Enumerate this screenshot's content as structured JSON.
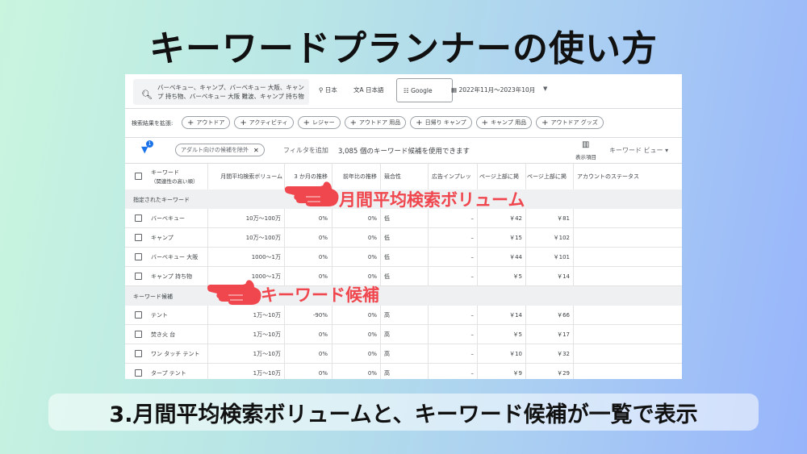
{
  "slide": {
    "title": "キーワードプランナーの使い方",
    "caption": "3.月間平均検索ボリュームと、キーワード候補が一覧で表示"
  },
  "toolbar": {
    "search_text": "バーベキュー、キャンプ、バーベキュー 大阪、キャンプ 持ち物、バーベキュー 大阪 難波、キャンプ 持ち物",
    "location": "日本",
    "language": "日本語",
    "engine": "Google",
    "date_range": "2022年11月～2023年10月"
  },
  "expand": {
    "label": "検索結果を拡張:",
    "chips": [
      "アウトドア",
      "アクティビティ",
      "レジャー",
      "アウトドア 用品",
      "日帰り キャンプ",
      "キャンプ 用品",
      "アウトドア グッズ"
    ]
  },
  "filter": {
    "badge": "1",
    "adult_chip": "アダルト向けの候補を除外",
    "add_filter": "フィルタを追加",
    "count_text": "3,085 個のキーワード候補を使用できます",
    "display_label": "表示項目",
    "view_label": "キーワード ビュー"
  },
  "table": {
    "headers": {
      "keyword": "キーワード",
      "keyword_sub": "（関連性の高い順）",
      "volume": "月間平均検索ボリューム",
      "three_month": "3 か月の推移",
      "yoy": "前年比の推移",
      "competition": "競合性",
      "ad_impression": "広告インプレッ",
      "bid_low": "ページ上部に掲",
      "bid_high": "ページ上部に掲",
      "status": "アカウントのステータス"
    },
    "group1": "指定されたキーワード",
    "group2": "キーワード候補",
    "rows1": [
      {
        "kw": "バーベキュー",
        "vol": "10万～100万",
        "m3": "0%",
        "yoy": "0%",
        "comp": "低",
        "imp": "–",
        "low": "￥42",
        "high": "￥81"
      },
      {
        "kw": "キャンプ",
        "vol": "10万～100万",
        "m3": "0%",
        "yoy": "0%",
        "comp": "低",
        "imp": "–",
        "low": "￥15",
        "high": "￥102"
      },
      {
        "kw": "バーベキュー 大阪",
        "vol": "1000～1万",
        "m3": "0%",
        "yoy": "0%",
        "comp": "低",
        "imp": "–",
        "low": "￥44",
        "high": "￥101"
      },
      {
        "kw": "キャンプ 持ち物",
        "vol": "1000～1万",
        "m3": "0%",
        "yoy": "0%",
        "comp": "低",
        "imp": "–",
        "low": "￥5",
        "high": "￥14"
      }
    ],
    "rows2": [
      {
        "kw": "テント",
        "vol": "1万～10万",
        "m3": "-90%",
        "yoy": "0%",
        "comp": "高",
        "imp": "–",
        "low": "￥14",
        "high": "￥66"
      },
      {
        "kw": "焚き火 台",
        "vol": "1万～10万",
        "m3": "0%",
        "yoy": "0%",
        "comp": "高",
        "imp": "–",
        "low": "￥5",
        "high": "￥17"
      },
      {
        "kw": "ワン タッチ テント",
        "vol": "1万～10万",
        "m3": "0%",
        "yoy": "0%",
        "comp": "高",
        "imp": "–",
        "low": "￥10",
        "high": "￥32"
      },
      {
        "kw": "タープ テント",
        "vol": "1万～10万",
        "m3": "0%",
        "yoy": "0%",
        "comp": "高",
        "imp": "–",
        "low": "￥9",
        "high": "￥29"
      }
    ]
  },
  "annotations": {
    "volume": "月間平均検索ボリューム",
    "candidates": "キーワード候補",
    "color": "#f0464e"
  }
}
